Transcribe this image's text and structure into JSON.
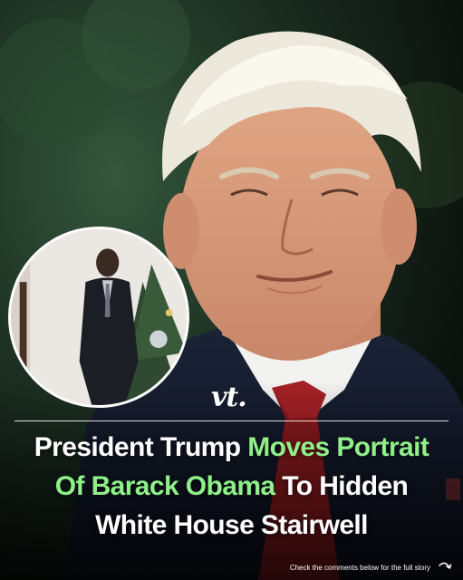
{
  "logo": {
    "text": "vt",
    "dot": "."
  },
  "headline": {
    "line1_white": "President Trump ",
    "line1_green": "Moves Portrait",
    "line2_green": "Of Barack Obama",
    "line2_white": " To Hidden",
    "line3_white": "White House Stairwell"
  },
  "footer": {
    "cta": "Check the comments below for the full story"
  },
  "colors": {
    "highlight": "#8ff08a",
    "text": "#ffffff",
    "background": "#1a2b1f"
  },
  "icons": {
    "footer_arrow": "curved-arrow-icon"
  }
}
